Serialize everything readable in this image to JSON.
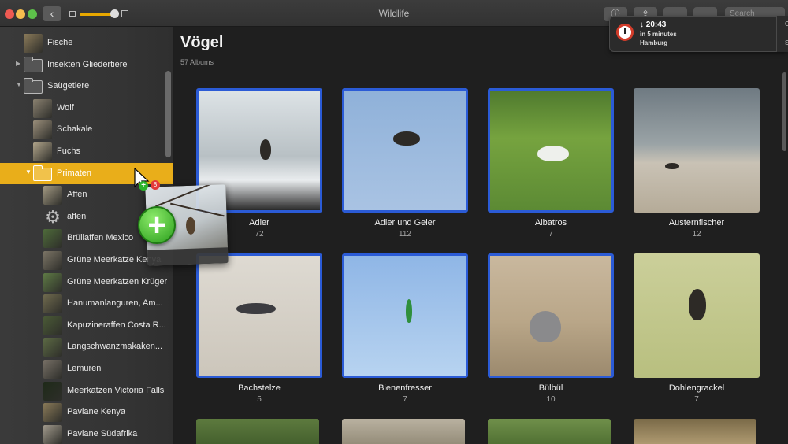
{
  "window": {
    "title": "Wildlife"
  },
  "toolbar": {
    "back_label": "‹",
    "search_placeholder": "Search"
  },
  "sidebar": {
    "items": [
      {
        "label": "Fische",
        "kind": "album",
        "color": "#8c7b5a"
      },
      {
        "label": "Insekten Gliedertiere",
        "kind": "folder",
        "arrow": "▶"
      },
      {
        "label": "Saügetiere",
        "kind": "folder",
        "arrow": "▼"
      },
      {
        "label": "Wolf",
        "kind": "album",
        "color": "#8a8170"
      },
      {
        "label": "Schakale",
        "kind": "album",
        "color": "#9a8e7a"
      },
      {
        "label": "Fuchs",
        "kind": "album",
        "color": "#b0a48a"
      },
      {
        "label": "Primaten",
        "kind": "folder",
        "arrow": "▼",
        "selected": true
      },
      {
        "label": "Affen",
        "kind": "album",
        "color": "#a39a83"
      },
      {
        "label": "affen",
        "kind": "smart",
        "icon": "gear-icon"
      },
      {
        "label": "Brüllaffen Mexico",
        "kind": "album",
        "color": "#4e6b3a"
      },
      {
        "label": "Grüne Meerkatze Kenya",
        "kind": "album",
        "color": "#7c7566"
      },
      {
        "label": "Grüne Meerkatzen Krüger",
        "kind": "album",
        "color": "#5e7a45"
      },
      {
        "label": "Hanumanlanguren, Am...",
        "kind": "album",
        "color": "#6f6a4e"
      },
      {
        "label": "Kapuzineraffen Costa R...",
        "kind": "album",
        "color": "#4a5a36"
      },
      {
        "label": "Langschwanzmakaken...",
        "kind": "album",
        "color": "#5c6a44"
      },
      {
        "label": "Lemuren",
        "kind": "album",
        "color": "#777066"
      },
      {
        "label": "Meerkatzen Victoria Falls",
        "kind": "album",
        "color": "#1e2a18"
      },
      {
        "label": "Paviane Kenya",
        "kind": "album",
        "color": "#8a7a58"
      },
      {
        "label": "Paviane Südafrika",
        "kind": "album",
        "color": "#a19a8c"
      }
    ]
  },
  "main": {
    "title": "Vögel",
    "count_label": "57 Albums",
    "albums": [
      {
        "name": "Adler",
        "count": "72",
        "selected": true
      },
      {
        "name": "Adler und Geier",
        "count": "112",
        "selected": true
      },
      {
        "name": "Albatros",
        "count": "7",
        "selected": true
      },
      {
        "name": "Austernfischer",
        "count": "12",
        "selected": false
      },
      {
        "name": "Bachstelze",
        "count": "5",
        "selected": true
      },
      {
        "name": "Bienenfresser",
        "count": "7",
        "selected": true
      },
      {
        "name": "Bülbül",
        "count": "10",
        "selected": true
      },
      {
        "name": "Dohlengrackel",
        "count": "7",
        "selected": false
      }
    ]
  },
  "notification": {
    "time": "↓ 20:43",
    "subtitle": "in 5 minutes",
    "location": "Hamburg",
    "side_a": "G",
    "side_b": "S"
  },
  "drag": {
    "badge": "+",
    "mini_plus": "+",
    "mini_count": "8"
  },
  "colors": {
    "accent_selection": "#e9ae1a",
    "album_selected_border": "#2b5bd6"
  }
}
